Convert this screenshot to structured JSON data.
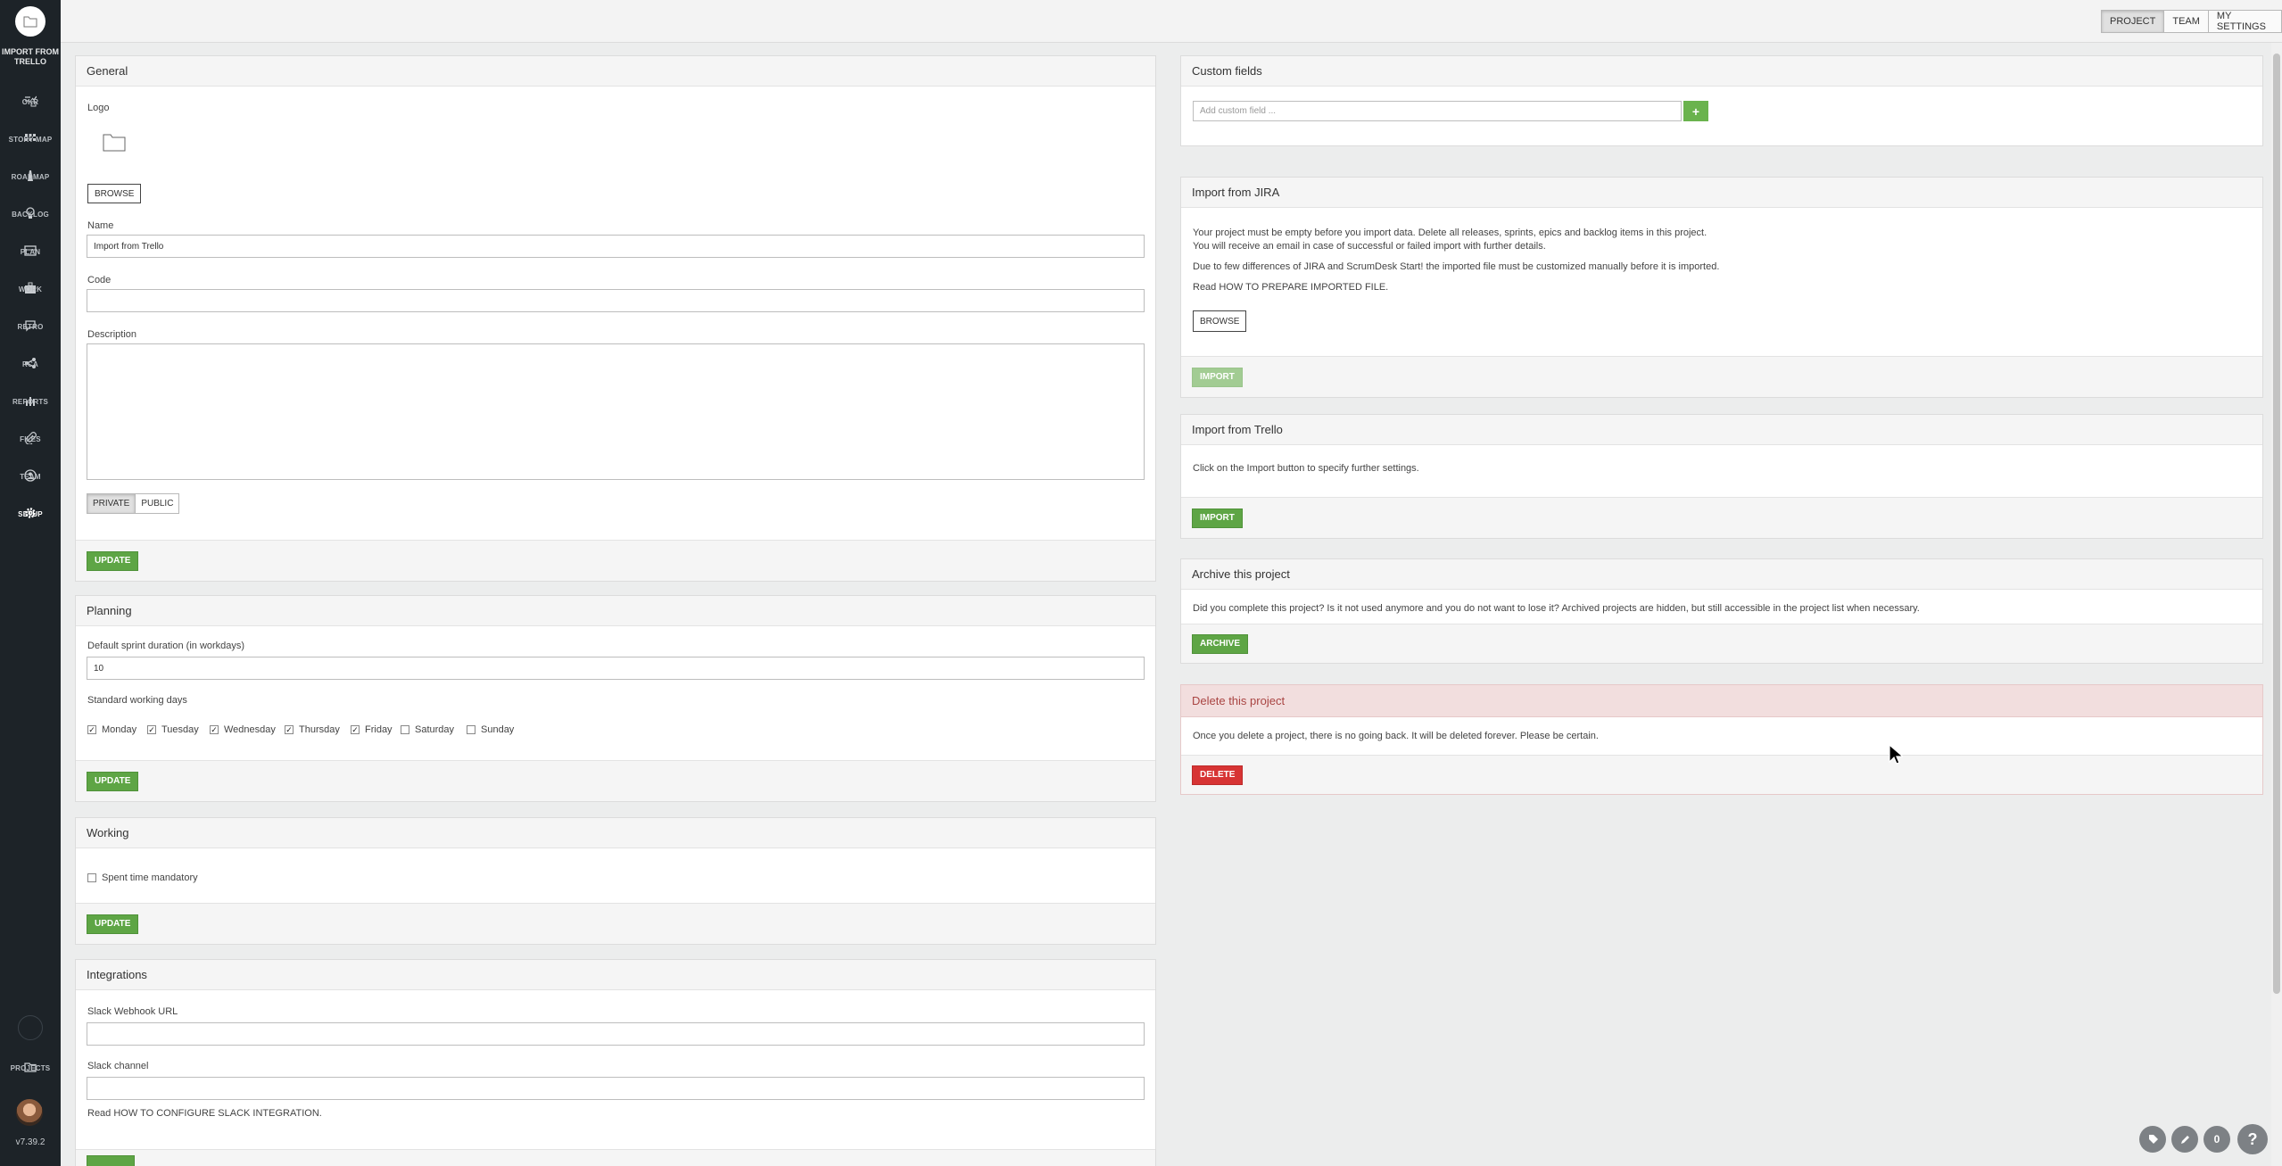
{
  "sidebar": {
    "project_name": "IMPORT FROM TRELLO",
    "items": [
      {
        "label": "OKR",
        "icon": "okr-icon"
      },
      {
        "label": "STORY MAP",
        "icon": "story-map-icon"
      },
      {
        "label": "ROADMAP",
        "icon": "roadmap-icon"
      },
      {
        "label": "BACKLOG",
        "icon": "backlog-icon"
      },
      {
        "label": "PLAN",
        "icon": "plan-icon"
      },
      {
        "label": "WORK",
        "icon": "work-icon"
      },
      {
        "label": "RETRO",
        "icon": "retro-icon"
      },
      {
        "label": "RCA",
        "icon": "rca-icon"
      },
      {
        "label": "REPORTS",
        "icon": "reports-icon"
      },
      {
        "label": "FILES",
        "icon": "files-icon"
      },
      {
        "label": "TEAM",
        "icon": "team-icon"
      },
      {
        "label": "SETUP",
        "icon": "gear-icon"
      }
    ],
    "projects_label": "PROJECTS",
    "version": "v7.39.2"
  },
  "topbar": {
    "tabs": [
      "PROJECT",
      "TEAM",
      "MY SETTINGS"
    ],
    "active_tab": "PROJECT"
  },
  "general": {
    "title": "General",
    "logo_label": "Logo",
    "browse": "BROWSE",
    "name_label": "Name",
    "name_value": "Import from Trello",
    "code_label": "Code",
    "code_value": "",
    "description_label": "Description",
    "description_value": "",
    "visibility": [
      "PRIVATE",
      "PUBLIC"
    ],
    "visibility_selected": "PRIVATE",
    "update": "UPDATE"
  },
  "planning": {
    "title": "Planning",
    "sprint_label": "Default sprint duration (in workdays)",
    "sprint_value": "10",
    "days_label": "Standard working days",
    "days": [
      {
        "name": "Monday",
        "checked": true
      },
      {
        "name": "Tuesday",
        "checked": true
      },
      {
        "name": "Wednesday",
        "checked": true
      },
      {
        "name": "Thursday",
        "checked": true
      },
      {
        "name": "Friday",
        "checked": true
      },
      {
        "name": "Saturday",
        "checked": false
      },
      {
        "name": "Sunday",
        "checked": false
      }
    ],
    "update": "UPDATE"
  },
  "working": {
    "title": "Working",
    "spent_time_label": "Spent time mandatory",
    "spent_time_checked": false,
    "update": "UPDATE"
  },
  "integrations": {
    "title": "Integrations",
    "webhook_label": "Slack Webhook URL",
    "webhook_value": "",
    "channel_label": "Slack channel",
    "channel_value": "",
    "help_text": "Read HOW TO CONFIGURE SLACK INTEGRATION."
  },
  "custom_fields": {
    "title": "Custom fields",
    "placeholder": "Add custom field ...",
    "add": "+"
  },
  "jira": {
    "title": "Import from JIRA",
    "line1": "Your project must be empty before you import data. Delete all releases, sprints, epics and backlog items in this project.",
    "line2": "You will receive an email in case of successful or failed import with further details.",
    "line3": "Due to few differences of JIRA and ScrumDesk Start! the imported file must be customized manually before it is imported.",
    "line4": "Read HOW TO PREPARE IMPORTED FILE.",
    "browse": "BROWSE",
    "import": "IMPORT"
  },
  "trello": {
    "title": "Import from Trello",
    "text": "Click on the Import button to specify further settings.",
    "import": "IMPORT"
  },
  "archive": {
    "title": "Archive this project",
    "text": "Did you complete this project? Is it not used anymore and you do not want to lose it? Archived projects are hidden, but still accessible in the project list when necessary.",
    "button": "ARCHIVE"
  },
  "delete": {
    "title": "Delete this project",
    "text": "Once you delete a project, there is no going back. It will be deleted forever. Please be certain.",
    "button": "DELETE"
  },
  "fabs": {
    "count": "0",
    "help": "?"
  },
  "colors": {
    "sidebar": "#1d2328",
    "green": "#5ea545",
    "red": "#d73434",
    "danger_header": "#f2dede"
  }
}
